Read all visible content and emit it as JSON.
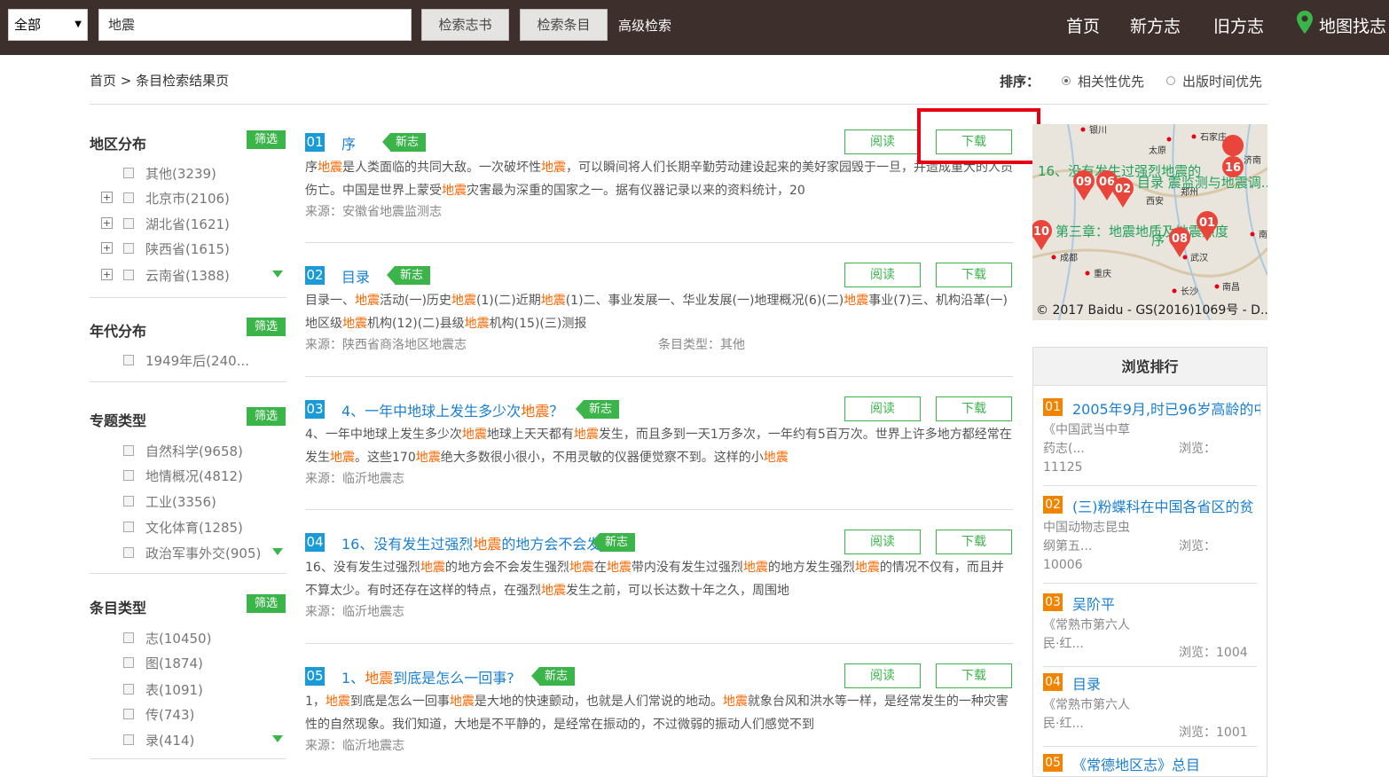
{
  "topbar": {
    "scope_select": "全部",
    "search_value": "地震",
    "btn_search_books": "检索志书",
    "btn_search_items": "检索条目",
    "advanced": "高级检索",
    "nav": [
      "首页",
      "新方志",
      "旧方志",
      "地图找志"
    ]
  },
  "breadcrumb": "首页 > 条目检索结果页",
  "sort": {
    "label": "排序：",
    "options": [
      "相关性优先",
      "出版时间优先"
    ],
    "selected": "相关性优先"
  },
  "filters": {
    "filter_label": "筛选",
    "region": {
      "title": "地区分布",
      "items": [
        "其他(3239)",
        "北京市(2106)",
        "湖北省(1621)",
        "陕西省(1615)",
        "云南省(1388)"
      ]
    },
    "era": {
      "title": "年代分布",
      "items": [
        "1949年后(240..."
      ]
    },
    "topic": {
      "title": "专题类型",
      "items": [
        "自然科学(9658)",
        "地情概况(4812)",
        "工业(3356)",
        "文化体育(1285)",
        "政治军事外交(905)"
      ]
    },
    "entry": {
      "title": "条目类型",
      "items": [
        "志(10450)",
        "图(1874)",
        "表(1091)",
        "传(743)",
        "录(414)"
      ]
    }
  },
  "results": [
    {
      "num": "01",
      "title_pre": "序",
      "title_hl": "",
      "title_post": "",
      "tag": "新志",
      "read": "阅读",
      "download": "下载",
      "text": "序<em>地震</em>是人类面临的共同大敌。一次破坏性<em>地震</em>，可以瞬间将人们长期辛勤劳动建设起来的美好家园毁于一旦，并造成重大的人员伤亡。中国是世界上蒙受<em>地震</em>灾害最为深重的国家之一。据有仪器记录以来的资料统计，20",
      "source": "来源：安徽省地震监测志",
      "type": ""
    },
    {
      "num": "02",
      "title_pre": "目录",
      "title_hl": "",
      "title_post": "",
      "tag": "新志",
      "read": "阅读",
      "download": "下载",
      "text": "目录一、<em>地震</em>活动(一)历史<em>地震</em>(1)(二)近期<em>地震</em>(1)二、事业发展一、华业发展(一)地理概况(6)(二)<em>地震</em>事业(7)三、机构沿革(一)地区级<em>地震</em>机构(12)(二)县级<em>地震</em>机构(15)(三)测报",
      "source": "来源：陕西省商洛地区地震志",
      "type": "条目类型：其他"
    },
    {
      "num": "03",
      "title_pre": "4、一年中地球上发生多少次",
      "title_hl": "地震",
      "title_post": "？",
      "tag": "新志",
      "read": "阅读",
      "download": "下载",
      "text": "4、一年中地球上发生多少次<em>地震</em>地球上天天都有<em>地震</em>发生，而且多到一天1万多次，一年约有5百万次。世界上许多地方都经常在发生<em>地震</em>。这些170<em>地震</em>绝大多数很小很小，不用灵敏的仪器便觉察不到。这样的小<em>地震</em>",
      "source": "来源：临沂地震志",
      "type": ""
    },
    {
      "num": "04",
      "title_pre": "16、没有发生过强烈",
      "title_hl": "地震",
      "title_post": "的地方会不会发",
      "tag": "新志",
      "read": "阅读",
      "download": "下载",
      "text": "16、没有发生过强烈<em>地震</em>的地方会不会发生强烈<em>地震</em>在<em>地震</em>带内没有发生过强烈<em>地震</em>的地方发生强烈<em>地震</em>的情况不仅有，而且并不算太少。有时还存在这样的特点，在强烈<em>地震</em>发生之前，可以长达数十年之久，周围地",
      "source": "来源：临沂地震志",
      "type": ""
    },
    {
      "num": "05",
      "title_pre": "1、",
      "title_hl": "地震",
      "title_post": "到底是怎么一回事?",
      "tag": "新志",
      "read": "阅读",
      "download": "下载",
      "text": "1，<em>地震</em>到底是怎么一回事<em>地震</em>是大地的快速颤动，也就是人们常说的地动。<em>地震</em>就象台风和洪水等一样，是经常发生的一种灾害性的自然现象。我们知道，大地是不平静的，是经常在振动的，不过微弱的振动人们感觉不到",
      "source": "来源：临沂地震志",
      "type": ""
    }
  ],
  "map": {
    "cities": [
      "银川",
      "石家庄",
      "太原",
      "济南",
      "郑州",
      "西安",
      "成都",
      "重庆",
      "武汉",
      "长沙",
      "南昌",
      "南"
    ],
    "markers": [
      "16",
      "09",
      "06",
      "02",
      "01",
      "10",
      "08"
    ],
    "labels": [
      "16、没有发生过强烈地震的",
      "目录 震监测与地震调...",
      "第三章：地震地质及地震烈度",
      "序"
    ],
    "copyright": "© 2017 Baidu - GS(2016)1069号 - D..."
  },
  "ranking": {
    "title": "浏览排行",
    "items": [
      {
        "n": "01",
        "title": "2005年9月,时已96岁高龄的中",
        "src": "《中国武当中草药志(...",
        "views_label": "浏览：",
        "views": "11125"
      },
      {
        "n": "02",
        "title": "(三)粉蝶科在中国各省区的贫",
        "src": "中国动物志昆虫纲第五...",
        "views_label": "浏览：",
        "views": "10006"
      },
      {
        "n": "03",
        "title": "吴阶平",
        "src": "《常熟市第六人民·红...",
        "views_label": "浏览：1004",
        "views": ""
      },
      {
        "n": "04",
        "title": "目录",
        "src": "《常熟市第六人民·红...",
        "views_label": "浏览：1001",
        "views": ""
      },
      {
        "n": "05",
        "title": "《常德地区志》总目",
        "src": "",
        "views_label": "",
        "views": ""
      }
    ]
  },
  "colors": {
    "topbar": "#3d2f2c",
    "green": "#3bb54a",
    "blue": "#1a9bd7",
    "orange": "#f08300",
    "highlight": "#ff6600",
    "red_box": "#e60012"
  }
}
